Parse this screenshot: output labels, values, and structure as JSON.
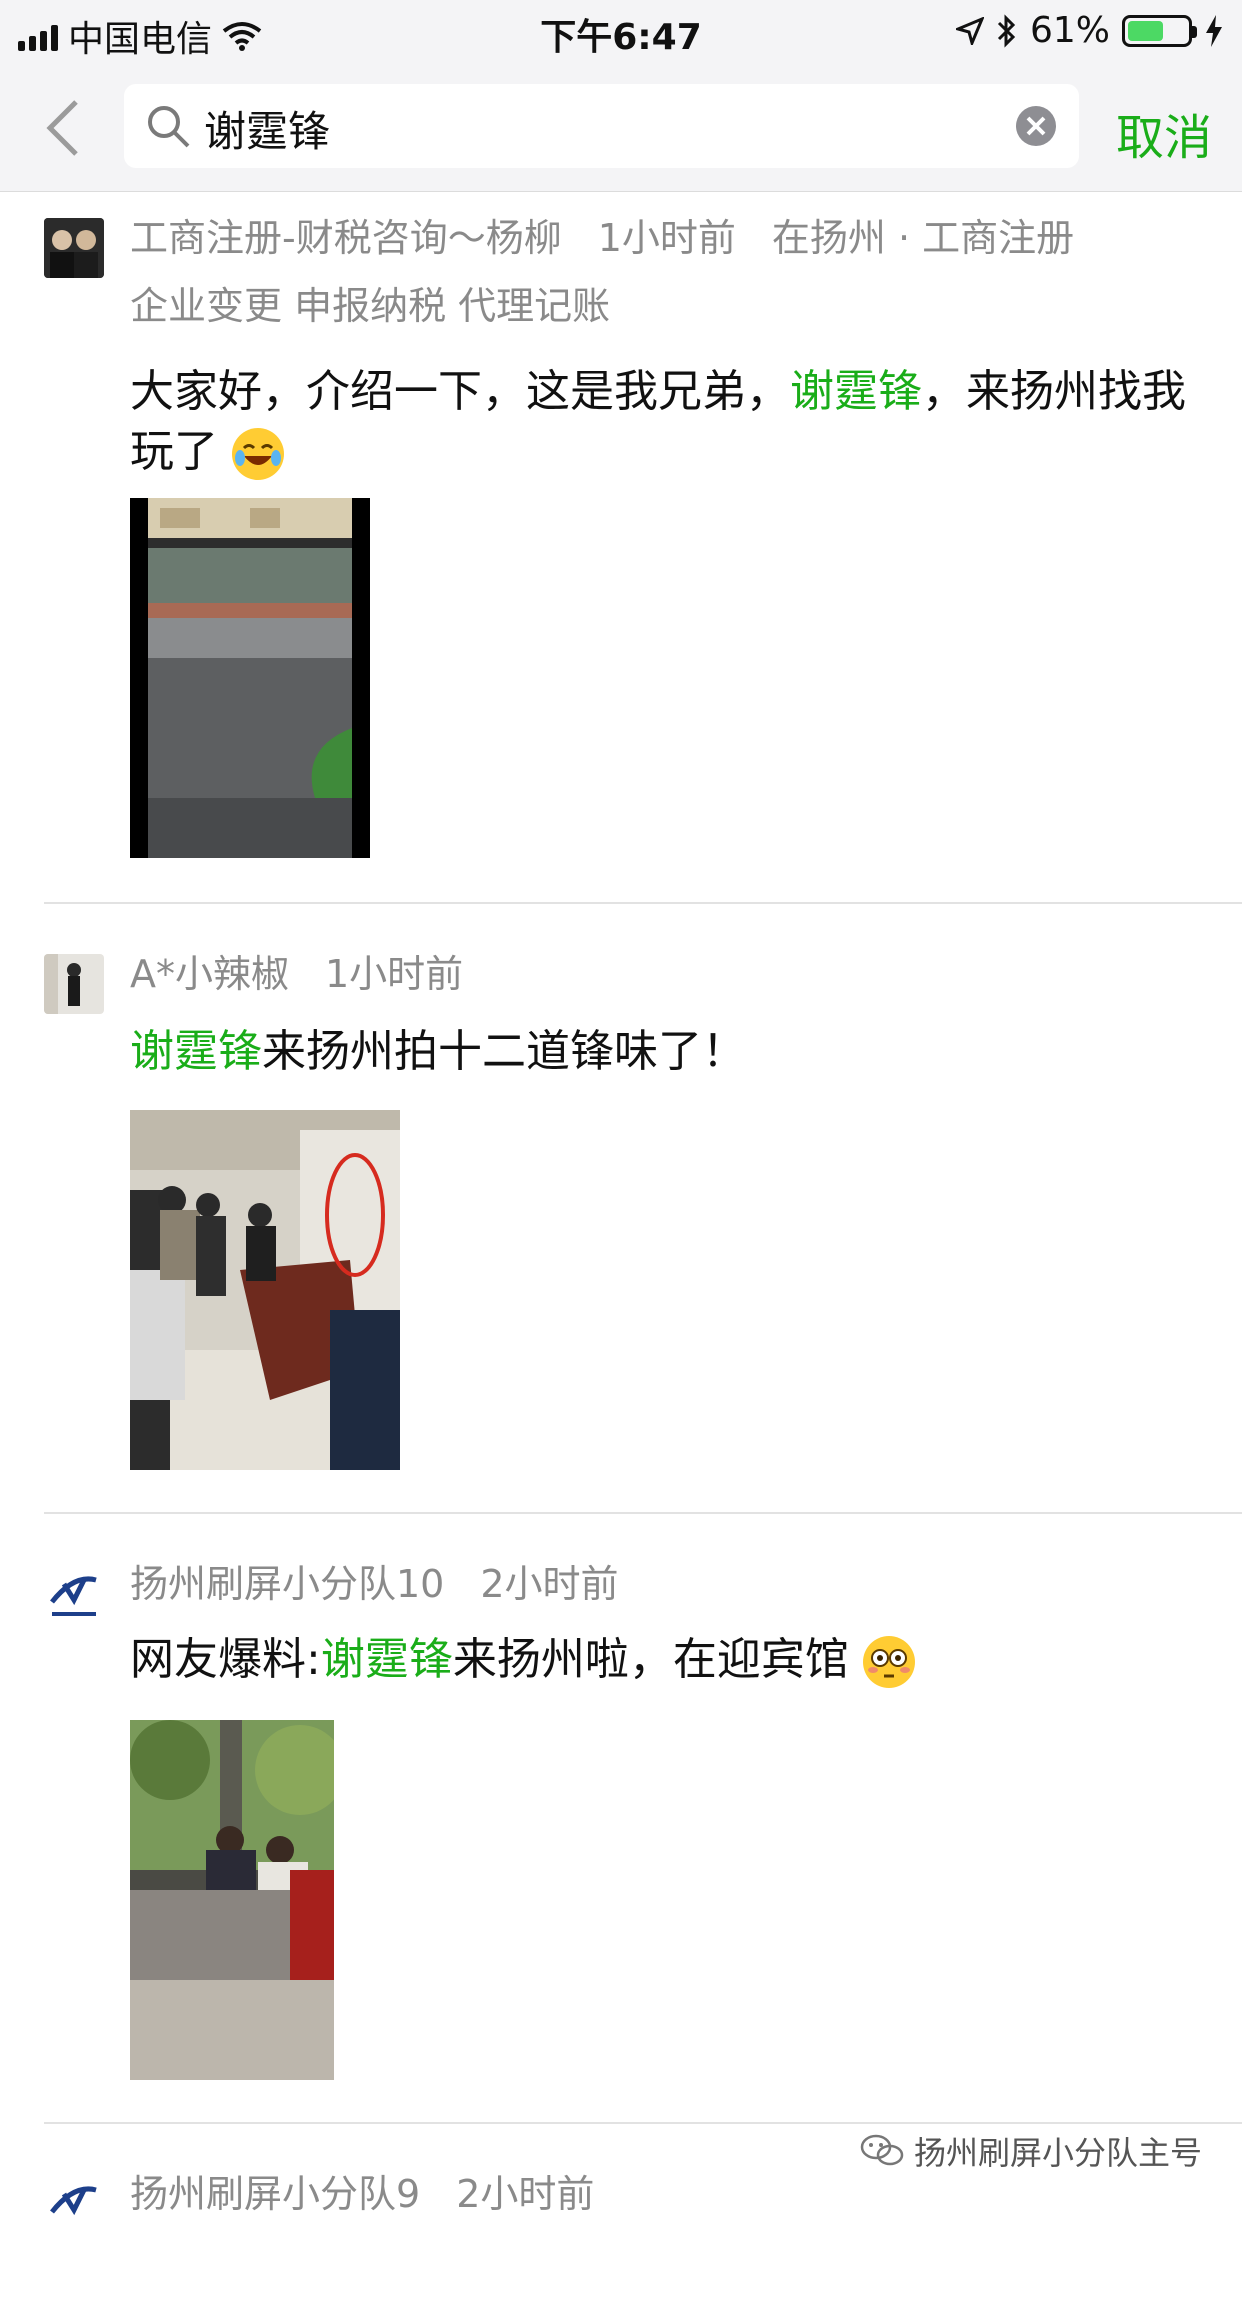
{
  "status_bar": {
    "carrier": "中国电信",
    "time": "下午6:47",
    "battery": "61%",
    "battery_level": 0.61
  },
  "search": {
    "query": "谢霆锋",
    "cancel_label": "取消"
  },
  "posts": [
    {
      "author": "工商注册-财税咨询～杨柳",
      "time_ago": "1小时前",
      "location": "在扬州 · 工商注册",
      "location_extra": "企业变更 申报纳税 代理记账",
      "text_before": "大家好，介绍一下，这是我兄弟，",
      "highlight": "谢霆锋",
      "text_after": "，来扬州找我玩了",
      "emoji": "laughing-with-tears-emoji"
    },
    {
      "author": "A*小辣椒",
      "time_ago": "1小时前",
      "text_before": "",
      "highlight": "谢霆锋",
      "text_after": "来扬州拍十二道锋味了！"
    },
    {
      "author": "扬州刷屏小分队10",
      "time_ago": "2小时前",
      "text_before": "网友爆料:",
      "highlight": "谢霆锋",
      "text_after": "来扬州啦，在迎宾馆",
      "emoji": "flushed-face-emoji"
    },
    {
      "author": "扬州刷屏小分队9",
      "time_ago": "2小时前"
    }
  ],
  "watermark": "扬州刷屏小分队主号",
  "colors": {
    "accent_green": "#1aad19",
    "meta_gray": "#8a8a8a",
    "bar_bg": "#f4f4f6"
  }
}
